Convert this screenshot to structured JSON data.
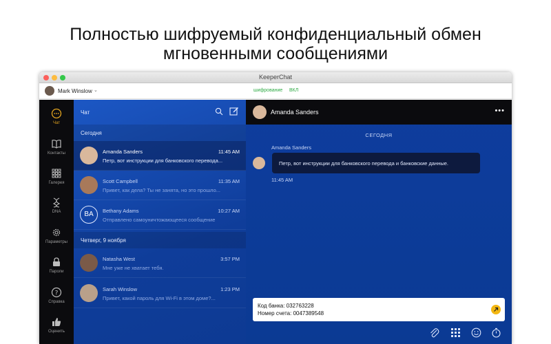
{
  "headline": {
    "line1": "Полностью шифруемый конфиденциальный обмен",
    "line2": "мгновенными сообщениями"
  },
  "window": {
    "title": "KeeperChat"
  },
  "userbar": {
    "name": "Mark Winslow",
    "encryption_label": "шифрование",
    "encryption_value": "ВКЛ"
  },
  "sidebar": {
    "items": [
      {
        "label": "Чат",
        "icon": "chat-icon",
        "active": true
      },
      {
        "label": "Контакты",
        "icon": "contacts-icon"
      },
      {
        "label": "Галерея",
        "icon": "gallery-icon"
      },
      {
        "label": "DNA",
        "icon": "dna-icon"
      },
      {
        "label": "Параметры",
        "icon": "gear-icon"
      },
      {
        "label": "Пароли",
        "icon": "lock-icon"
      },
      {
        "label": "Справка",
        "icon": "help-icon"
      },
      {
        "label": "Оценить",
        "icon": "thumbs-up-icon"
      }
    ]
  },
  "chatlist": {
    "title": "Чат",
    "sections": [
      {
        "label": "Сегодня"
      },
      {
        "label": "Четверг, 9 ноября"
      }
    ],
    "rows": [
      {
        "name": "Amanda Sanders",
        "time": "11:45 AM",
        "message": "Петр, вот инструкции для банковского перевода...",
        "avatar_color": "#d9b89c"
      },
      {
        "name": "Scott Campbell",
        "time": "11:35 AM",
        "message": "Привет, как дела? Ты не занята, но это прошло...",
        "avatar_color": "#a8795a"
      },
      {
        "name": "Bethany Adams",
        "time": "10:27 AM",
        "message": "Отправлено самоуничтожающееся сообщение",
        "initials": "BA"
      },
      {
        "name": "Natasha West",
        "time": "3:57 PM",
        "message": "Мне уже не хватает тебя.",
        "avatar_color": "#7a5a48"
      },
      {
        "name": "Sarah Winslow",
        "time": "1:23 PM",
        "message": "Привет, какой пароль для Wi-Fi в этом доме?...",
        "avatar_color": "#b9a08a"
      }
    ]
  },
  "chat": {
    "contact_name": "Amanda Sanders",
    "day_label": "СЕГОДНЯ",
    "sender": "Amanda Sanders",
    "message": "Петр, вот инструкции для банковского перевода и банковские данные.",
    "time": "11:45 AM",
    "composer_line1": "Код банка: 032763228",
    "composer_line2": "Номер счета: 0047389548",
    "more_glyph": "•••"
  },
  "colors": {
    "accent": "#e3a520",
    "encryption_green": "#2eaa44",
    "list_blue": "#1c57c4",
    "chat_blue": "#0e3d9e"
  }
}
